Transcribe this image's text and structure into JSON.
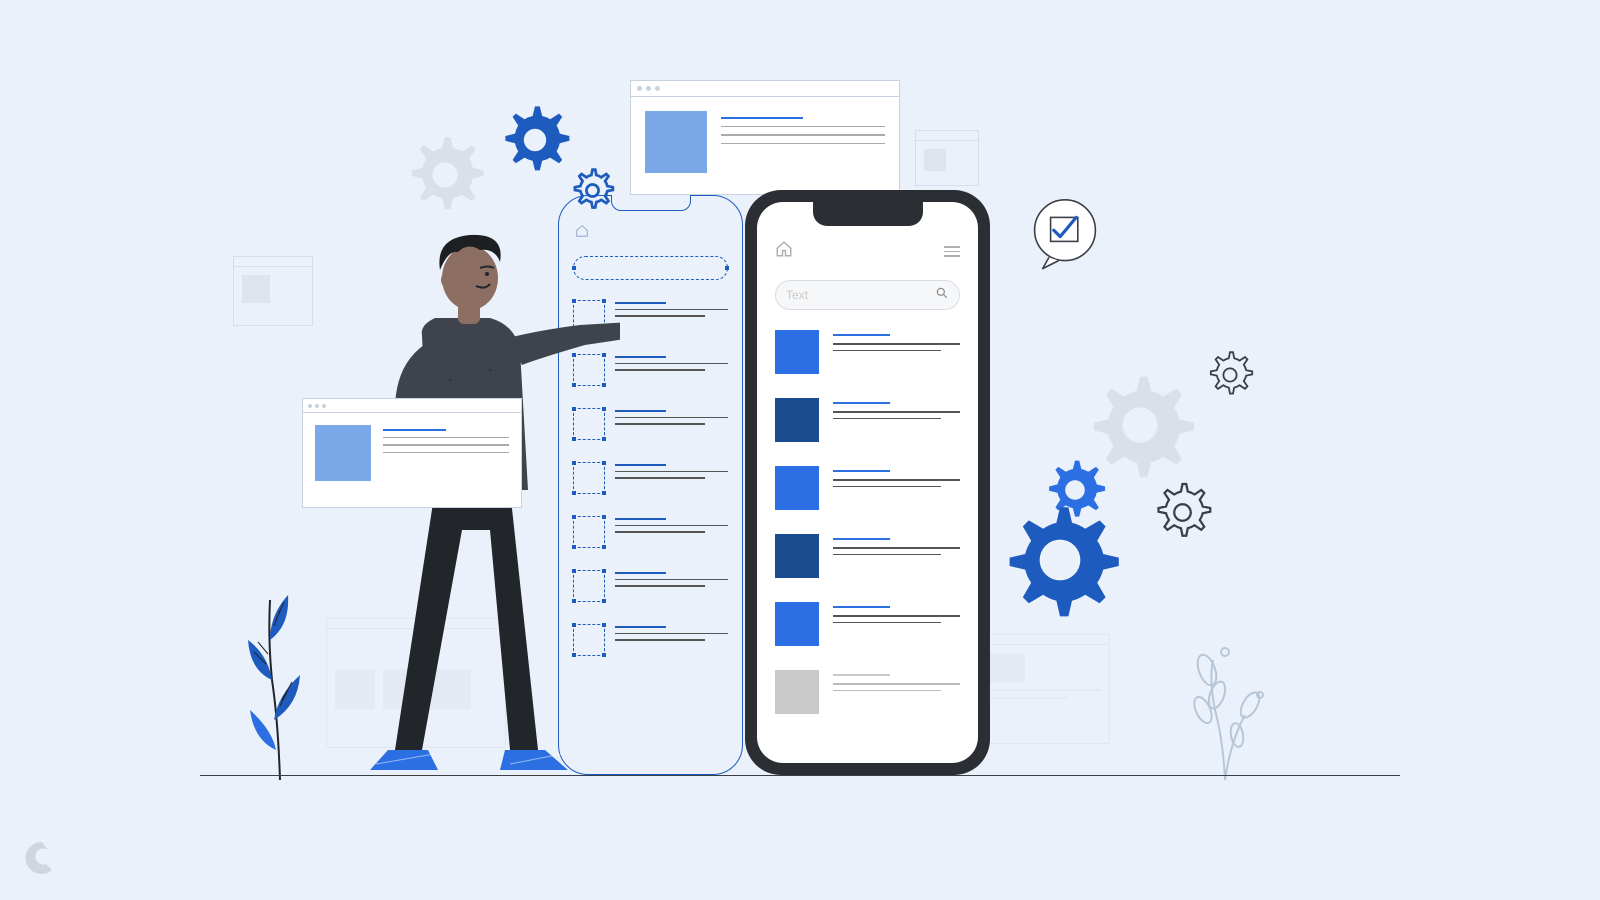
{
  "phone": {
    "search": {
      "placeholder": "Text"
    },
    "list_items": [
      {
        "color": "blue1"
      },
      {
        "color": "blue2"
      },
      {
        "color": "blue1"
      },
      {
        "color": "blue2"
      },
      {
        "color": "blue1"
      },
      {
        "color": "grey"
      }
    ]
  },
  "wireframe": {
    "item_count": 7
  },
  "colors": {
    "accent": "#2b6fe3",
    "accent_dark": "#1a4c8f",
    "bg": "#eaf1fa",
    "grey": "#c9c9c9",
    "light_blue": "#7ba8e8"
  },
  "icons": {
    "home": "home-icon",
    "menu": "hamburger-icon",
    "search": "search-icon",
    "check": "check-icon",
    "gear": "gear-icon"
  }
}
